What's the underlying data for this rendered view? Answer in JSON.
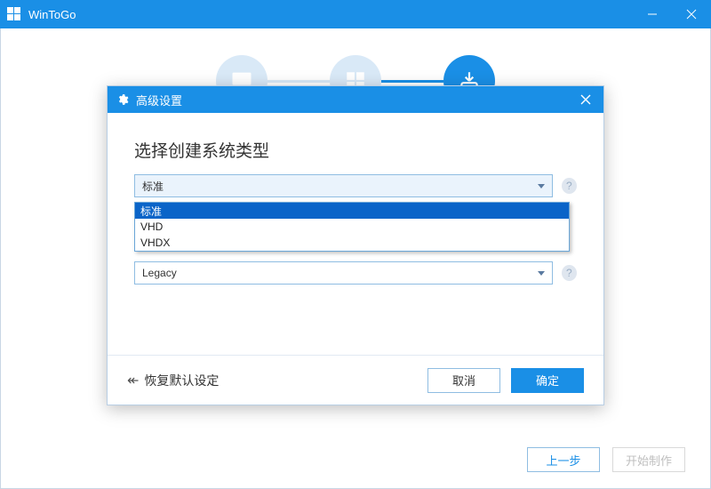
{
  "titlebar": {
    "title": "WinToGo"
  },
  "mainfooter": {
    "back": "上一步",
    "start": "开始制作"
  },
  "modal": {
    "title": "高级设置",
    "section1": {
      "label": "选择创建系统类型",
      "selected": "标准",
      "options": [
        "标准",
        "VHD",
        "VHDX"
      ]
    },
    "section2": {
      "selected": "Legacy"
    },
    "restore": "恢复默认设定",
    "cancel": "取消",
    "ok": "确定"
  },
  "colors": {
    "accent": "#1a8fe6"
  }
}
